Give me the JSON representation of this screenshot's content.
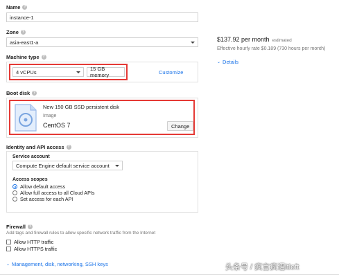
{
  "name": {
    "label": "Name",
    "value": "instance-1"
  },
  "zone": {
    "label": "Zone",
    "value": "asia-east1-a"
  },
  "machine_type": {
    "label": "Machine type",
    "cpus": "4 vCPUs",
    "memory": "15 GB memory",
    "customize": "Customize"
  },
  "boot_disk": {
    "label": "Boot disk",
    "title": "New 150 GB SSD persistent disk",
    "image_label": "Image",
    "image": "CentOS 7",
    "change": "Change"
  },
  "identity": {
    "label": "Identity and API access",
    "service_account_label": "Service account",
    "service_account": "Compute Engine default service account",
    "scopes_label": "Access scopes",
    "scopes": [
      {
        "label": "Allow default access",
        "selected": true
      },
      {
        "label": "Allow full access to all Cloud APIs",
        "selected": false
      },
      {
        "label": "Set access for each API",
        "selected": false
      }
    ]
  },
  "firewall": {
    "label": "Firewall",
    "description": "Add tags and firewall rules to allow specific network traffic from the Internet",
    "options": [
      "Allow HTTP traffic",
      "Allow HTTPS traffic"
    ]
  },
  "more": {
    "label": "Management, disk, networking, SSH keys"
  },
  "pricing": {
    "price": "$137.92 per month",
    "estimated": "estimated",
    "hourly": "Effective hourly rate $0.189 (730 hours per month)",
    "details": "Details"
  },
  "watermark": "头条号 / 疯言疯语itloft",
  "colors": {
    "accent": "#1a73e8",
    "highlight": "#e53935",
    "border": "#e0e0e0"
  }
}
